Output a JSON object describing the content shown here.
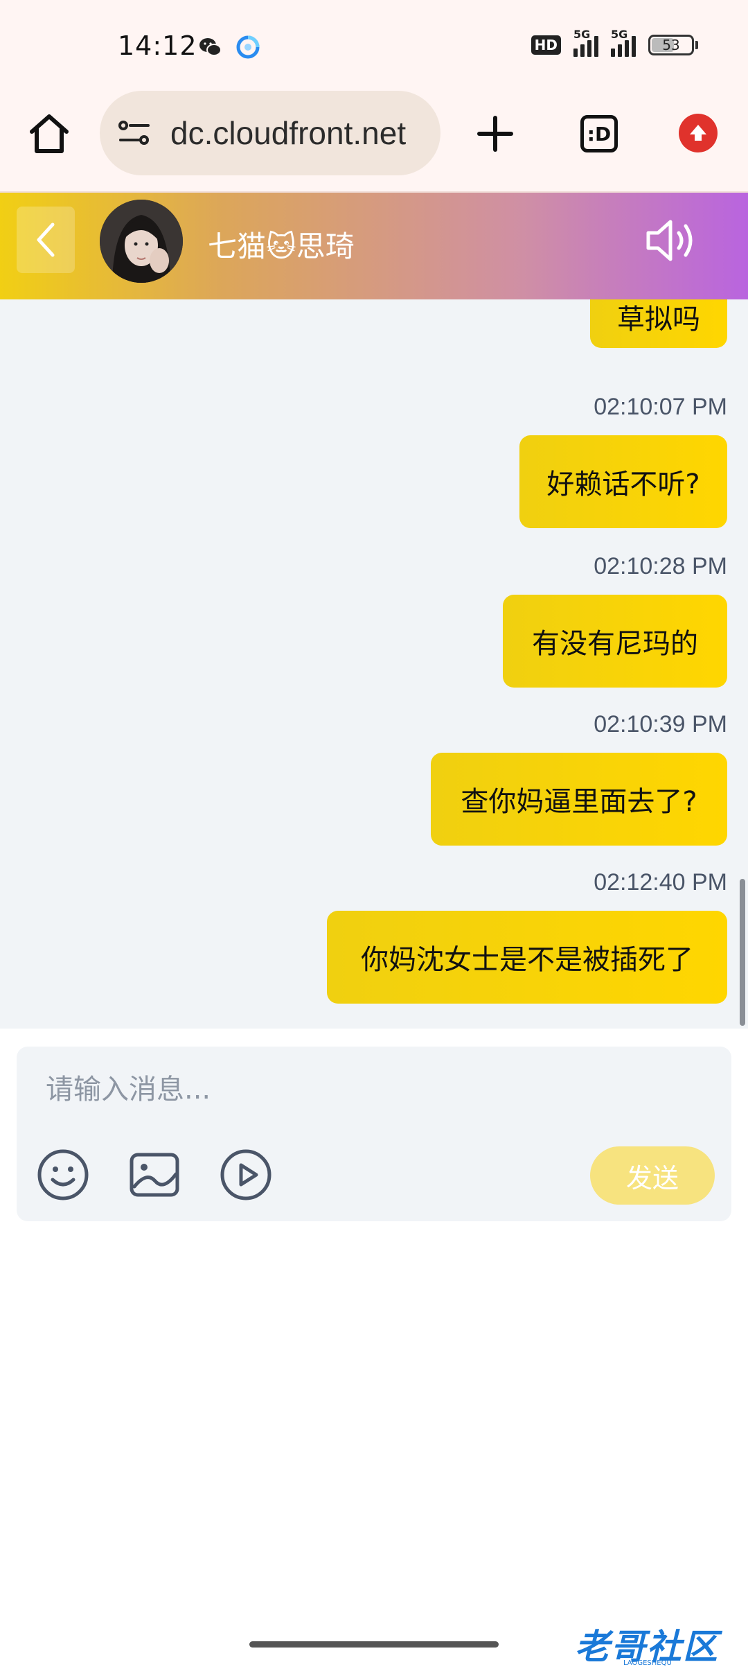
{
  "status_bar": {
    "time": "14:12",
    "app_icons": [
      "wechat-icon",
      "browser-app-icon"
    ],
    "hd_badge": "HD",
    "signal_1": "5G",
    "signal_2": "5G",
    "battery": "53"
  },
  "browser": {
    "url": "dc.cloudfront.net",
    "tabs_label": ":D",
    "icons": [
      "home-icon",
      "site-settings-icon",
      "plus-icon",
      "tabs-icon",
      "update-icon"
    ]
  },
  "chat": {
    "contact_name": "七猫🐱思琦",
    "icons": [
      "back-icon",
      "avatar",
      "speaker-icon"
    ]
  },
  "messages": [
    {
      "time": "",
      "text": "草拟吗"
    },
    {
      "time": "02:10:07 PM",
      "text": "好赖话不听?"
    },
    {
      "time": "02:10:28 PM",
      "text": "有没有尼玛的"
    },
    {
      "time": "02:10:39 PM",
      "text": "查你妈逼里面去了?"
    },
    {
      "time": "02:12:40 PM",
      "text": "你妈沈女士是不是被插死了"
    }
  ],
  "composer": {
    "placeholder": "请输入消息...",
    "send_label": "发送",
    "tool_icons": [
      "emoji-icon",
      "image-icon",
      "video-icon"
    ]
  },
  "watermark": {
    "text": "老哥社区",
    "sub": "LAOGESHEQU"
  },
  "colors": {
    "bubble": "#ffd600",
    "header_gradient_start": "#f1cf14",
    "header_gradient_end": "#b964df",
    "send_button": "#f7e37f"
  }
}
